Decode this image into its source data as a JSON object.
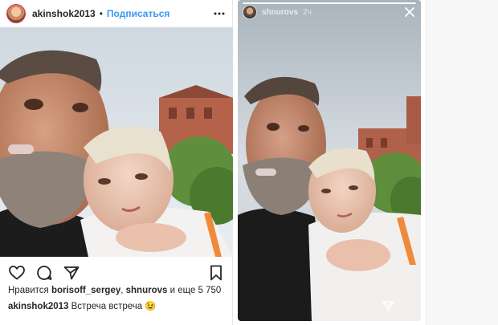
{
  "post": {
    "username": "akinshok2013",
    "separator": "•",
    "follow_label": "Подписаться",
    "icons": {
      "more": "more-dots-icon",
      "like": "heart-icon",
      "comment": "comment-icon",
      "share": "send-icon",
      "save": "bookmark-icon"
    },
    "likes": {
      "prefix": "Нравится",
      "user1": "borisoff_sergey",
      "sep": ",",
      "user2": "shnurovs",
      "suffix": "и еще 5 750"
    },
    "caption": {
      "username": "akinshok2013",
      "text": "Встреча встреча",
      "emoji": "😉"
    }
  },
  "story": {
    "username": "shnurovs",
    "time": "2ч",
    "icons": {
      "close": "close-icon",
      "send": "send-icon"
    }
  },
  "colors": {
    "link_blue": "#3897f0",
    "text": "#262626",
    "avatar_ring": "#e1306c"
  }
}
